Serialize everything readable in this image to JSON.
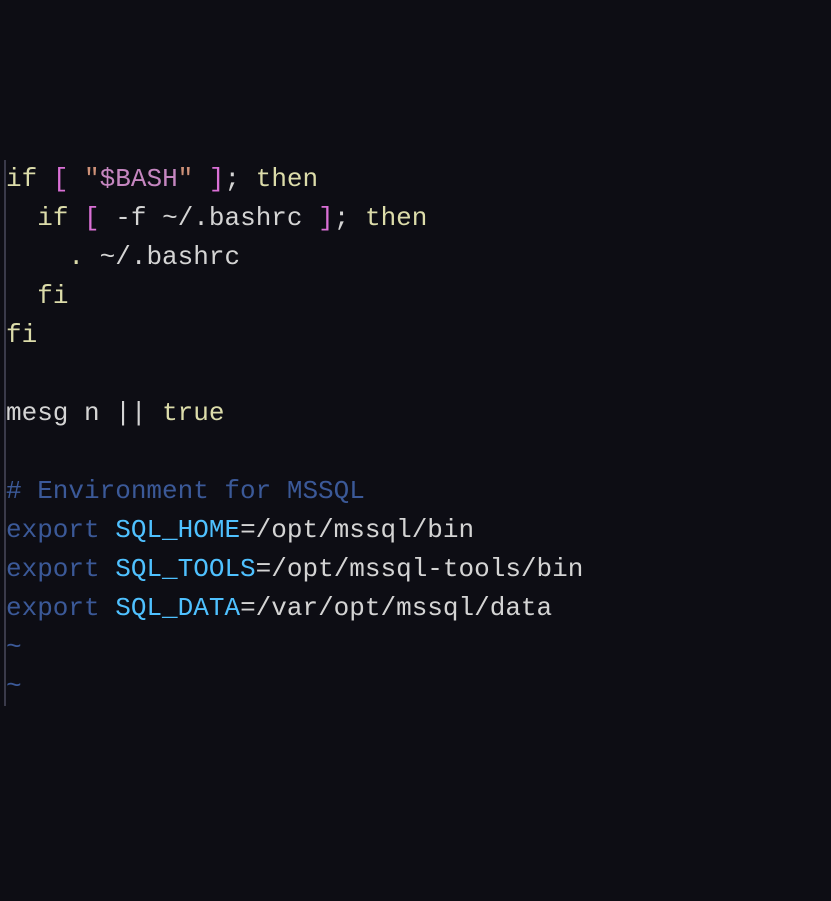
{
  "lines": {
    "l1": {
      "if": "if",
      "bracket_open": "[",
      "quote_open": "\"",
      "var": "$BASH",
      "quote_close": "\"",
      "bracket_close": "]",
      "semi": ";",
      "then": "then"
    },
    "l2": {
      "if": "if",
      "bracket_open": "[",
      "flag": "-f",
      "path": "~/.bashrc",
      "bracket_close": "]",
      "semi": ";",
      "then": "then"
    },
    "l3": {
      "dot": ".",
      "path": "~/.bashrc"
    },
    "l4": {
      "fi": "fi"
    },
    "l5": {
      "fi": "fi"
    },
    "l6": {
      "mesg": "mesg",
      "n": "n",
      "pipes": "||",
      "true": "true"
    },
    "l7": {
      "comment": "# Environment for MSSQL"
    },
    "l8": {
      "export": "export",
      "var": "SQL_HOME",
      "eq": "=",
      "val": "/opt/mssql/bin"
    },
    "l9": {
      "export": "export",
      "var": "SQL_TOOLS",
      "eq": "=",
      "val": "/opt/mssql-tools/bin"
    },
    "l10": {
      "export": "export",
      "var": "SQL_DATA",
      "eq": "=",
      "val": "/var/opt/mssql/data"
    },
    "tilde": "~"
  }
}
